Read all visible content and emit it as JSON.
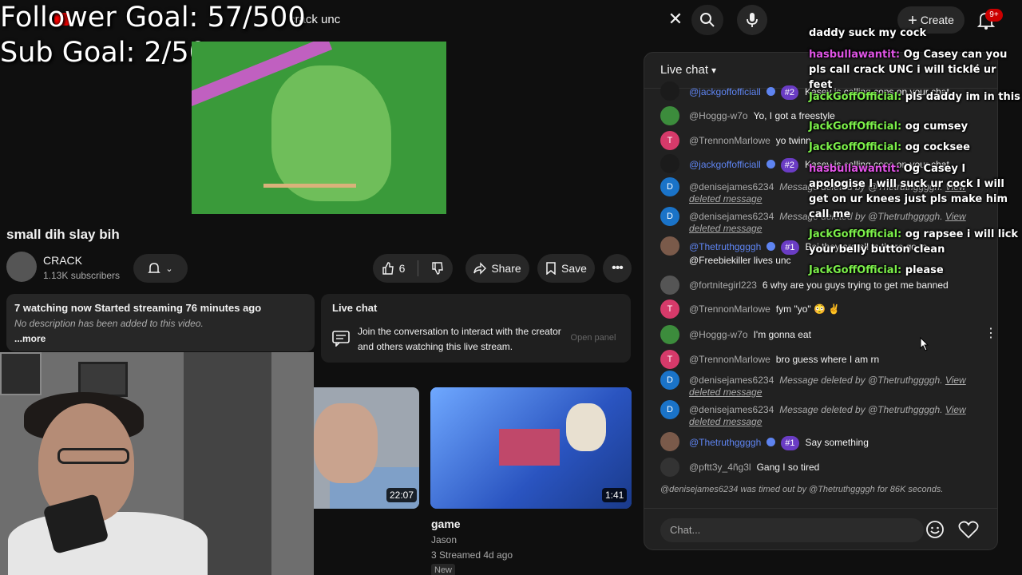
{
  "overlay": {
    "follower_goal": "Follower Goal: 57/500",
    "sub_goal": "Sub Goal: 2/50"
  },
  "topbar": {
    "search_value": "crack unc",
    "create_label": "Create",
    "notif_count": "9+"
  },
  "video": {
    "title": "small dih slay bih",
    "channel_name": "CRACK",
    "subscribers": "1.13K subscribers",
    "like_count": "6",
    "share_label": "Share",
    "save_label": "Save"
  },
  "description": {
    "meta": "7 watching now  Started streaming 76 minutes ago",
    "text": "No description has been added to this video.",
    "more": "...more"
  },
  "chat_promo": {
    "title": "Live chat",
    "text": "Join the conversation to interact with the creator and others watching this live stream.",
    "button": "Open panel"
  },
  "recommended": [
    {
      "duration": "22:07"
    },
    {
      "duration": "1:41",
      "title": "game",
      "channel": "Jason",
      "meta": "3  Streamed 4d ago",
      "badge": "New"
    }
  ],
  "live_chat": {
    "header": "Live chat",
    "messages": [
      {
        "author": "@jackgoffofficiall",
        "badge": "#2",
        "text": "Kasey is calling cops on your chat",
        "avatar_color": "#1b1b1b",
        "avatar_letter": ""
      },
      {
        "author": "@Hoggg-w7o",
        "text": "Yo, I got a freestyle",
        "avatar_color": "#3c8c3c",
        "avatar_letter": ""
      },
      {
        "author": "@TrennonMarlowe",
        "text": "yo twinn",
        "avatar_color": "#d63a6a",
        "avatar_letter": "T"
      },
      {
        "author": "@jackgoffofficiall",
        "badge": "#2",
        "text": "Kasey is calling cops on your chat",
        "avatar_color": "#1b1b1b",
        "avatar_letter": ""
      },
      {
        "author": "@denisejames6234",
        "deleted": "Message deleted by @Thetruthggggh.",
        "link": "View deleted message",
        "avatar_color": "#1a73c8",
        "avatar_letter": "D"
      },
      {
        "author": "@denisejames6234",
        "deleted": "Message deleted by @Thetruthggggh.",
        "link": "View deleted message",
        "avatar_color": "#1a73c8",
        "avatar_letter": "D"
      },
      {
        "author": "@Thetruthggggh",
        "badge": "#1",
        "text": "Boi they are all in there go to @Freebiekiller lives unc",
        "avatar_color": "#7a5a4a",
        "avatar_letter": ""
      },
      {
        "author": "@fortnitegirl223",
        "text": "6 why are you guys trying to get me banned",
        "avatar_color": "#555555",
        "avatar_letter": ""
      },
      {
        "author": "@TrennonMarlowe",
        "text": "fym \"yo\" 😳 ✌",
        "avatar_color": "#d63a6a",
        "avatar_letter": "T"
      },
      {
        "author": "@Hoggg-w7o",
        "text": "I'm gonna eat",
        "avatar_color": "#3c8c3c",
        "avatar_letter": ""
      },
      {
        "author": "@TrennonMarlowe",
        "text": "bro guess where I am rn",
        "avatar_color": "#d63a6a",
        "avatar_letter": "T"
      },
      {
        "author": "@denisejames6234",
        "deleted": "Message deleted by @Thetruthggggh.",
        "link": "View deleted message",
        "avatar_color": "#1a73c8",
        "avatar_letter": "D"
      },
      {
        "author": "@denisejames6234",
        "deleted": "Message deleted by @Thetruthggggh.",
        "link": "View deleted message",
        "avatar_color": "#1a73c8",
        "avatar_letter": "D"
      },
      {
        "author": "@Thetruthggggh",
        "badge": "#1",
        "text": "Say something",
        "avatar_color": "#7a5a4a",
        "avatar_letter": ""
      },
      {
        "author": "@pftt3y_4ñg3l",
        "text": "Gang I so tired",
        "avatar_color": "#333333",
        "avatar_letter": ""
      }
    ],
    "timeout_notice": "@denisejames6234 was timed out by @Thetruthggggh for 86K seconds.",
    "input_placeholder": "Chat..."
  },
  "overlay_chat": [
    {
      "name": "",
      "text": "daddy suck my cock",
      "color": "#ffffff"
    },
    {
      "name": "hasbullawantit:",
      "text": "Og Casey can you pls call crack UNC i will tickle ur feet",
      "color": "#e054e6"
    },
    {
      "name": "JackGoffOfficial:",
      "text": "pls daddy im in this",
      "color": "#7cf04a"
    },
    {
      "name": "JackGoffOfficial:",
      "text": "og cumsey",
      "color": "#7cf04a"
    },
    {
      "name": "JackGoffOfficial:",
      "text": "og cocksee",
      "color": "#7cf04a"
    },
    {
      "name": "hasbullawantit:",
      "text": "Og Casey I apologise I will suck ur cock I will get on ur knees just pls make him call me",
      "color": "#e054e6"
    },
    {
      "name": "JackGoffOfficial:",
      "text": "og rapsee i will lick your belly button clean",
      "color": "#7cf04a"
    },
    {
      "name": "JackGoffOfficial:",
      "text": "please",
      "color": "#7cf04a"
    }
  ]
}
